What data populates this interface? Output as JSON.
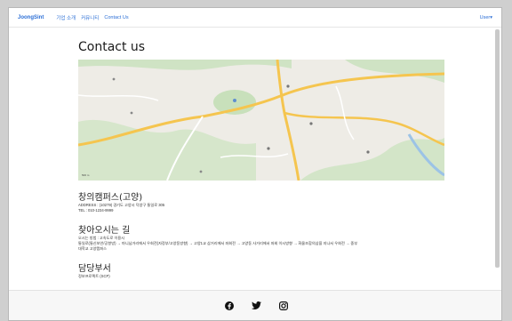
{
  "navbar": {
    "brand": "JoongSint",
    "links": [
      "기업 소개",
      "커뮤니티",
      "Contact Us"
    ],
    "user": "User▾"
  },
  "main": {
    "title": "Contact us",
    "map": {
      "scale": "500 m",
      "attribution": ""
    },
    "campus": {
      "title": "창의캠퍼스(고양)",
      "address": "ADDRESS : (10279) 경기도 고양시 덕양구 통일로 305",
      "tel": "TEL : 010-1234-9999"
    },
    "directions": {
      "title": "찾아오시는 길",
      "line1": "오시는 방법 : 고속도로 이용시",
      "line2": "통일로(통신보안/공항방) → 마니남거리에서 우회전(자정부/고양동방향) → 고양1교 삼거리에서 좌회전 → 고양동 사거리에서 좌회 이시방향 → 화물조합의삼을 지나서 우회전 → 중부",
      "line3": "대학교 고양캠퍼스"
    },
    "department": {
      "title": "담당부서",
      "line1": "정보프로젝트 (SCP)"
    }
  },
  "footer": {
    "icons": [
      "facebook-icon",
      "twitter-icon",
      "instagram-icon"
    ]
  }
}
